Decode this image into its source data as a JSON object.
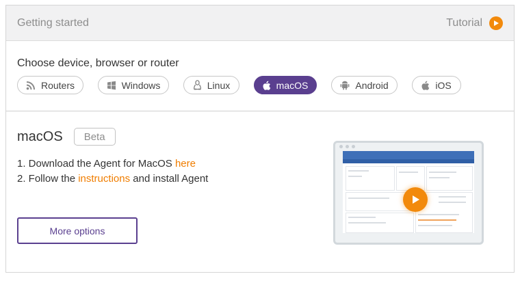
{
  "header": {
    "title": "Getting started",
    "tutorial_label": "Tutorial"
  },
  "devices": {
    "title": "Choose device, browser or router",
    "items": [
      {
        "label": "Routers",
        "icon": "rss-icon"
      },
      {
        "label": "Windows",
        "icon": "windows-icon"
      },
      {
        "label": "Linux",
        "icon": "linux-icon"
      },
      {
        "label": "macOS",
        "icon": "apple-icon"
      },
      {
        "label": "Android",
        "icon": "android-icon"
      },
      {
        "label": "iOS",
        "icon": "apple-icon"
      }
    ],
    "selected": "macOS"
  },
  "main": {
    "os_title": "macOS",
    "badge": "Beta",
    "steps": {
      "step1_prefix": "1. Download the Agent for MacOS ",
      "step1_link": "here",
      "step2_prefix": "2. Follow the ",
      "step2_link": "instructions",
      "step2_suffix": " and install Agent"
    },
    "more_button": "More options"
  },
  "colors": {
    "accent": "#5a3f8f",
    "link": "#f07d00",
    "play": "#f28a0c"
  }
}
